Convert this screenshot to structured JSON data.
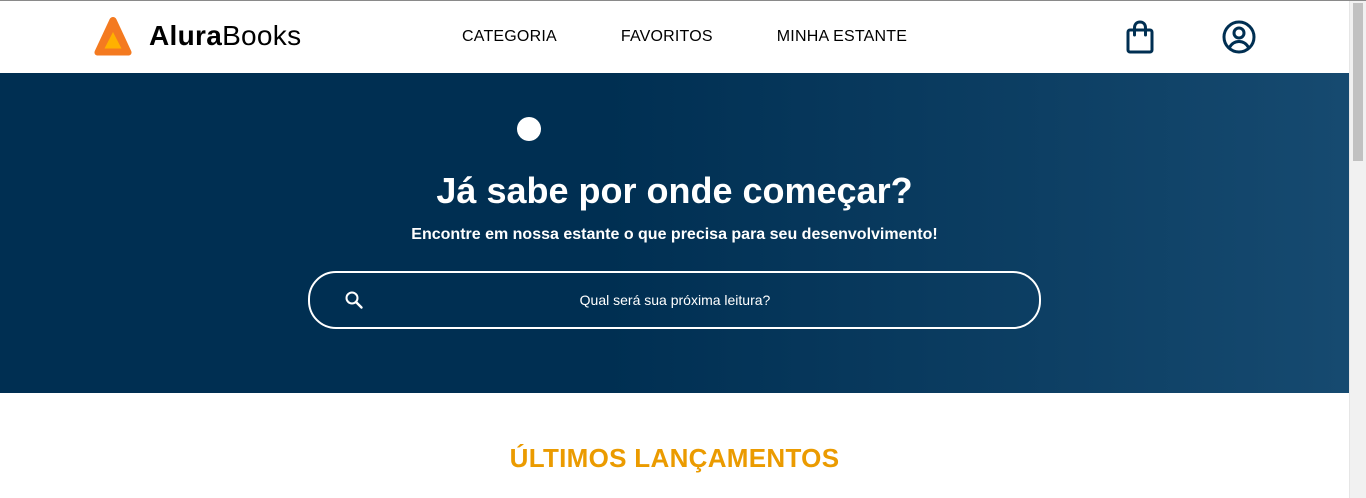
{
  "header": {
    "logo": {
      "name_bold": "Alura",
      "name_light": "Books",
      "icon": "alurabooks-logo-icon"
    },
    "nav": {
      "items": [
        {
          "label": "CATEGORIA"
        },
        {
          "label": "FAVORITOS"
        },
        {
          "label": "MINHA ESTANTE"
        }
      ]
    },
    "icons": {
      "bag": "shopping-bag-icon",
      "user": "user-profile-icon"
    }
  },
  "hero": {
    "title": "Já sabe por onde começar?",
    "subtitle": "Encontre em nossa estante o que precisa para seu desenvolvimento!",
    "search": {
      "placeholder": "Qual será sua próxima leitura?",
      "value": "",
      "icon": "search-icon"
    }
  },
  "releases": {
    "title": "ÚLTIMOS LANÇAMENTOS"
  },
  "colors": {
    "hero_bg": "#002f52",
    "hero_bg_end": "#164a70",
    "accent": "#eb9b00",
    "logo_orange": "#f47a20",
    "logo_yellow": "#ffb100",
    "icon_dark": "#002f52"
  }
}
